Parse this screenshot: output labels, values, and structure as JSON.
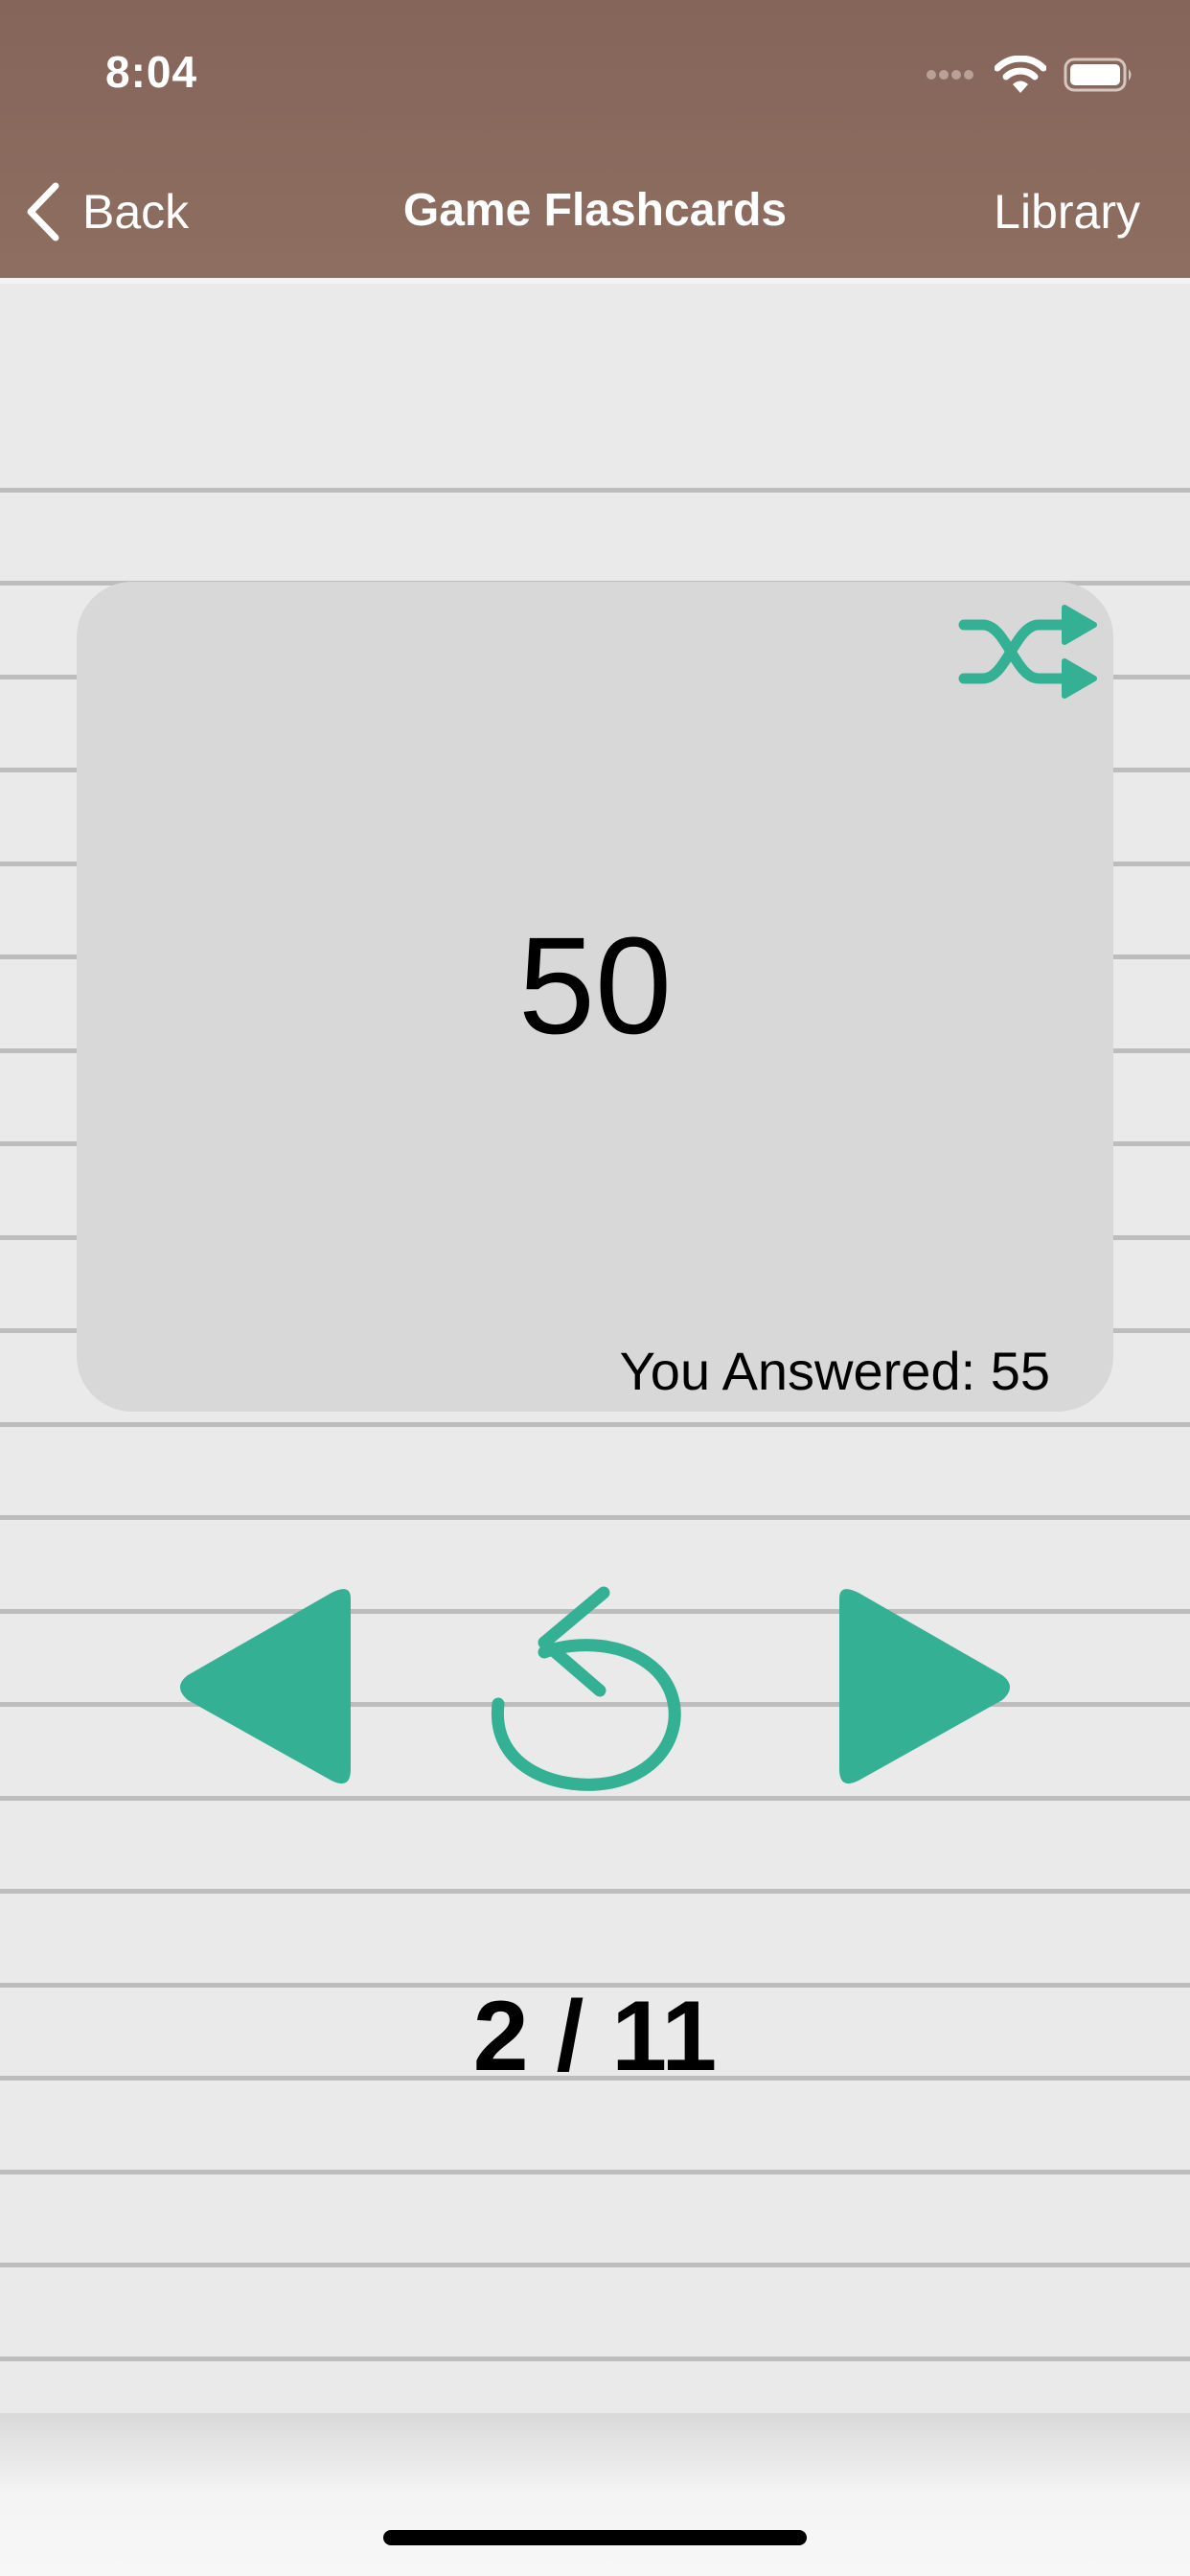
{
  "status_bar": {
    "time": "8:04",
    "signal_icon": "cellular-signal-icon",
    "wifi_icon": "wifi-icon",
    "battery_icon": "battery-icon"
  },
  "nav": {
    "back_label": "Back",
    "title": "Game Flashcards",
    "right_label": "Library"
  },
  "card": {
    "value": "50",
    "answer_text": "You Answered: 55"
  },
  "controls": {
    "previous_icon": "triangle-left-icon",
    "flip_icon": "undo-icon",
    "next_icon": "triangle-right-icon",
    "shuffle_icon": "shuffle-icon"
  },
  "progress": {
    "text": "2 / 11",
    "current": 2,
    "total": 11
  },
  "colors": {
    "header": "#85655a",
    "accent": "#34b194",
    "card": "#d8d8d8",
    "background": "#eaeaea",
    "rule_line": "#bdbdbd"
  }
}
